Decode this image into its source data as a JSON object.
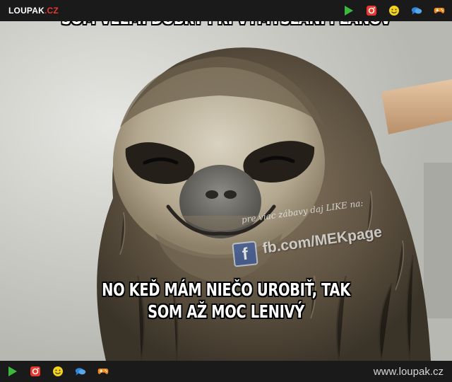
{
  "header": {
    "logo_text": "LOUPAK",
    "logo_tld": ".CZ",
    "icons": [
      "play-icon",
      "instagram-icon",
      "smiley-icon",
      "chat-icon",
      "gamepad-icon"
    ]
  },
  "meme": {
    "top_caption": "SOM VEĽMI DOBRÝ PRI VYMÝŠĽANÍ PLÁNOV",
    "bottom_caption": "NO KEĎ MÁM NIEČO UROBIŤ, TAK SOM AŽ MOC LENIVÝ"
  },
  "watermark": {
    "line1": "pre viac zábavy daj LIKE na:",
    "line2": "fb.com/MEKpage"
  },
  "footer": {
    "url": "www.loupak.cz"
  },
  "colors": {
    "bar_bg": "#1a1a1a",
    "logo_accent": "#e53b2f",
    "play": "#3cb93c",
    "instagram": "#e8382f",
    "smiley": "#f5d31a",
    "chat": "#2f86d8",
    "gamepad": "#f08a1c"
  }
}
